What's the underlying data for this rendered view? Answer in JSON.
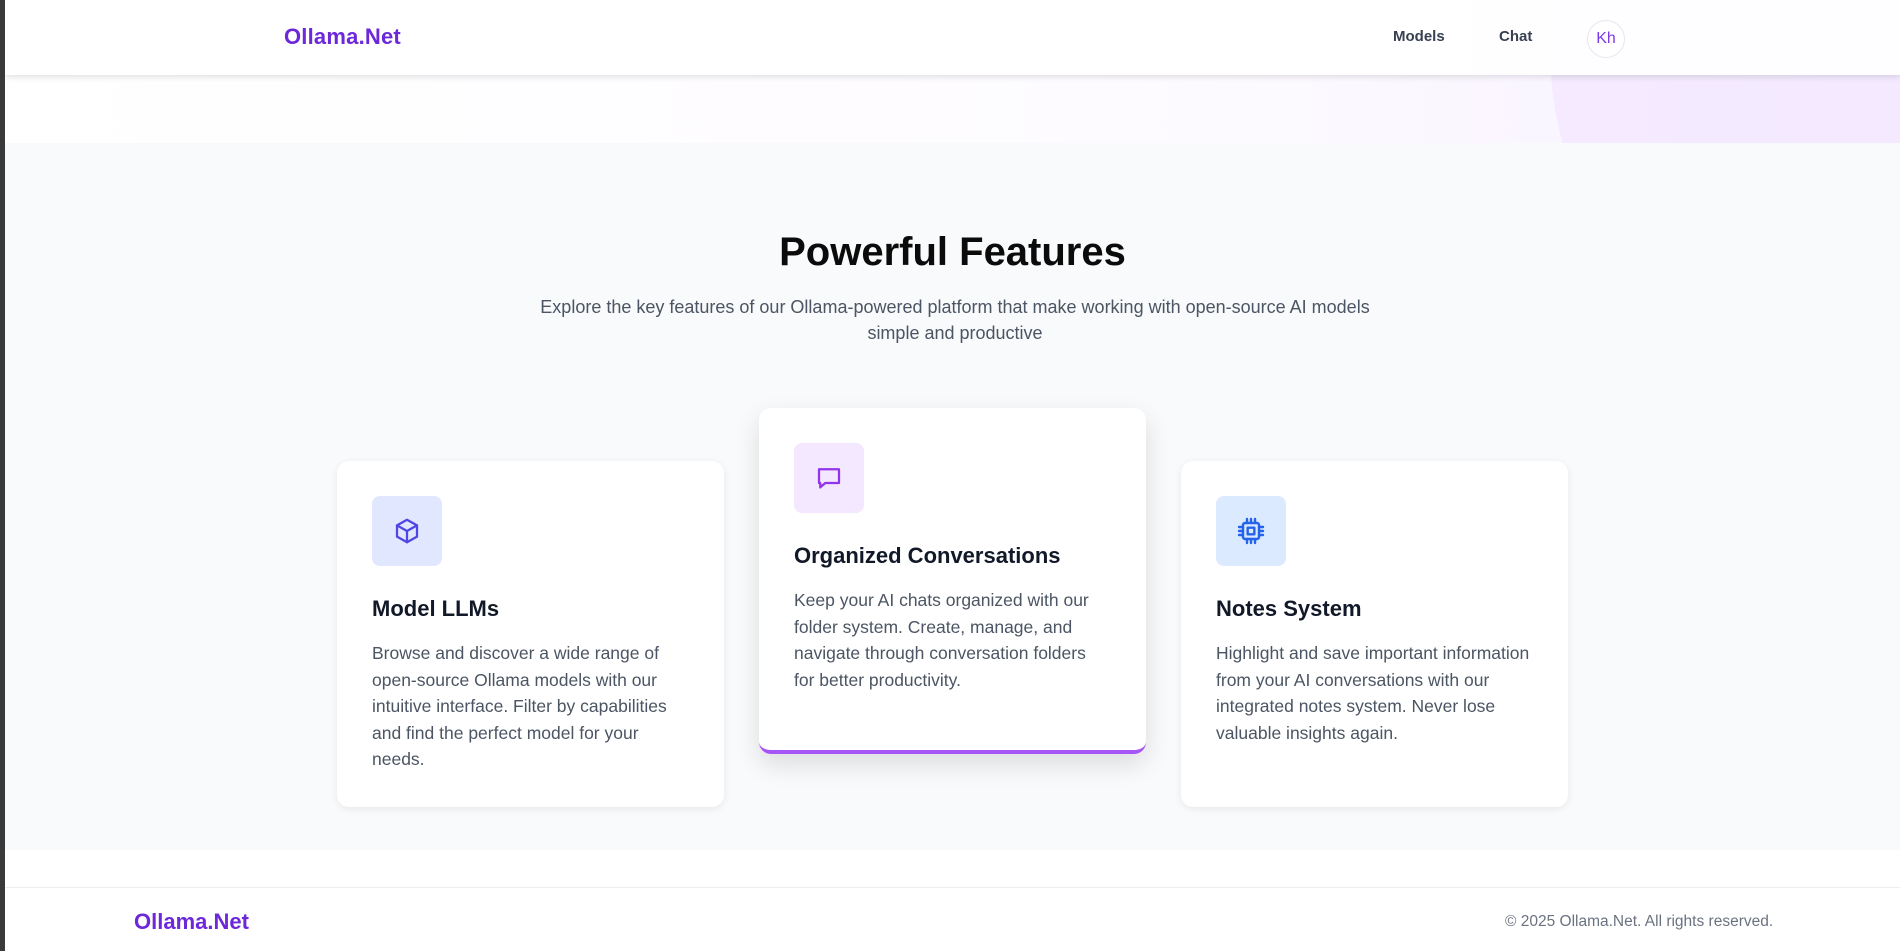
{
  "navbar": {
    "brand": "Ollama.Net",
    "links": [
      "Models",
      "Chat"
    ],
    "avatar_initials": "Kh"
  },
  "features": {
    "title": "Powerful Features",
    "subtitle": "Explore the key features of our Ollama-powered platform that make working with open-source AI models simple and productive",
    "cards": [
      {
        "icon": "cube-icon",
        "title": "Model LLMs",
        "description": "Browse and discover a wide range of open-source Ollama models with our intuitive interface. Filter by capabilities and find the perfect model for your needs."
      },
      {
        "icon": "chat-bubble-icon",
        "title": "Organized Conversations",
        "description": "Keep your AI chats organized with our folder system. Create, manage, and navigate through conversation folders for better productivity."
      },
      {
        "icon": "cpu-chip-icon",
        "title": "Notes System",
        "description": "Highlight and save important information from your AI conversations with our integrated notes system. Never lose valuable insights again."
      }
    ]
  },
  "footer": {
    "brand": "Ollama.Net",
    "copyright": "© 2025 Ollama.Net. All rights reserved."
  },
  "colors": {
    "brand": "#6d28d9",
    "accent": "#a855f7",
    "indigo_icon": "#4f46e5",
    "purple_icon": "#9333ea",
    "blue_icon": "#2563eb",
    "section_bg": "#f9fafb"
  }
}
